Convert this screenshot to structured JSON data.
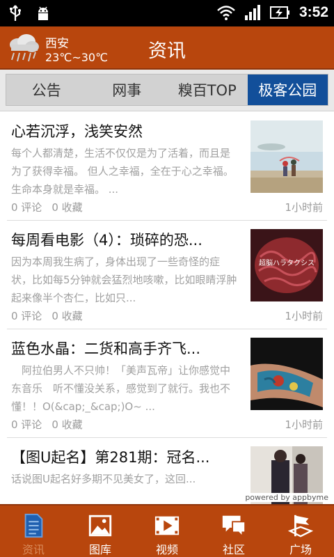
{
  "status_bar": {
    "time": "3:52"
  },
  "header": {
    "city": "西安",
    "temperature": "23℃~30℃",
    "title": "资讯"
  },
  "tabs": [
    {
      "label": "公告",
      "active": false
    },
    {
      "label": "网事",
      "active": false
    },
    {
      "label": "糗百TOP",
      "active": false
    },
    {
      "label": "极客公园",
      "active": true
    }
  ],
  "articles": [
    {
      "title": "心若沉浮，浅笑安然",
      "summary": "每个人都清楚，生活不仅仅是为了活着，而且是为了获得幸福。 但人之幸福，全在于心之幸福。生命本身就是幸福。 ...",
      "comments": "0 评论",
      "favorites": "0 收藏",
      "time": "1小时前",
      "thumb": "couple-landscape-photo"
    },
    {
      "title": "每周看电影（4）：琐碎的恐...",
      "summary": "因为本周我生病了，身体出现了一些奇怪的症状，比如每5分钟就会猛烈地咳嗽，比如眼睛浮肿起来像半个杏仁，比如只...",
      "comments": "0 评论",
      "favorites": "0 收藏",
      "time": "1小时前",
      "thumb": "brain-movie-poster",
      "thumb_text": "超脳ハラタクシス"
    },
    {
      "title": "蓝色水晶：二货和高手齐飞...",
      "summary": "　阿拉伯男人不只帅！「美声瓦帝」让你感觉中东音乐　听不懂没关系，感觉到了就行。我也不懂！！O(&cap;_&cap;)O~ ...",
      "comments": "0 评论",
      "favorites": "0 收藏",
      "time": "1小时前",
      "thumb": "tattoo-arm-photo"
    },
    {
      "title": "【图U起名】第281期：冠名...",
      "summary": "话说图U起名好多期不见美女了，这回...",
      "comments": "",
      "favorites": "",
      "time": "",
      "thumb": "street-fashion-photo"
    }
  ],
  "powered_by": "powered by appbyme",
  "bottom_nav": [
    {
      "label": "资讯",
      "icon": "news-icon",
      "active": true
    },
    {
      "label": "图库",
      "icon": "gallery-icon",
      "active": false
    },
    {
      "label": "视频",
      "icon": "video-icon",
      "active": false
    },
    {
      "label": "社区",
      "icon": "community-icon",
      "active": false
    },
    {
      "label": "广场",
      "icon": "plaza-icon",
      "active": false
    }
  ],
  "colors": {
    "brand": "#b8460d",
    "active_tab": "#124f9a",
    "nav_active_label": "#d98a5a"
  }
}
